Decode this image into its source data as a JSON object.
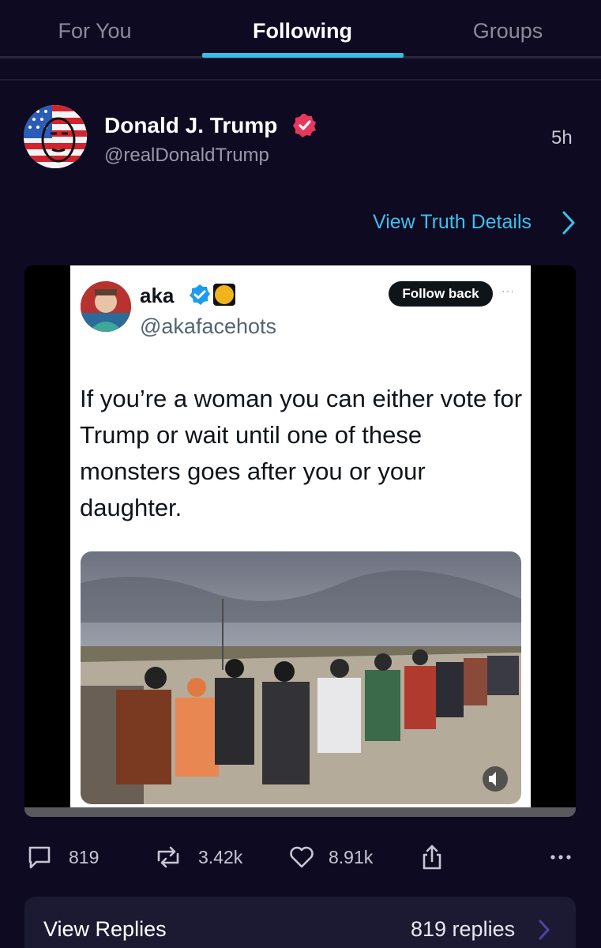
{
  "tabs": [
    {
      "label": "For You"
    },
    {
      "label": "Following"
    },
    {
      "label": "Groups"
    }
  ],
  "post": {
    "author_name": "Donald J. Trump",
    "handle": "@realDonaldTrump",
    "time": "5h",
    "details_link": "View Truth Details"
  },
  "embedded_tweet": {
    "name": "aka",
    "handle": "@akafacehots",
    "follow_label": "Follow back",
    "more": "···",
    "text": "If you’re a woman you can either vote for Trump or wait until one of these monsters goes after you or your daughter."
  },
  "actions": {
    "replies": "819",
    "retruths": "3.42k",
    "likes": "8.91k"
  },
  "replies_bar": {
    "label": "View Replies",
    "count": "819 replies"
  },
  "colors": {
    "background": "#0d0a21",
    "accent": "#37bde6",
    "verified": "#e8365d"
  }
}
